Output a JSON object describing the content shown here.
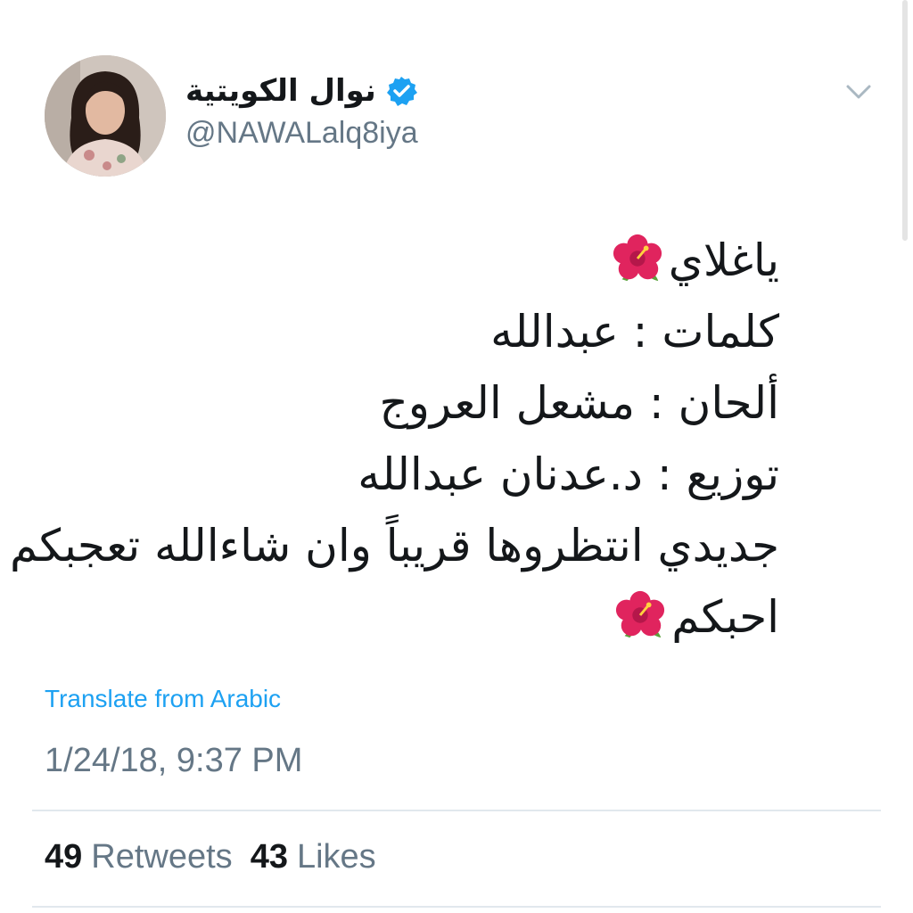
{
  "user": {
    "display_name": "نوال الكويتية",
    "handle": "@NAWALalq8iya",
    "verified_icon": "verified-badge-icon",
    "avatar_icon": "avatar-photo"
  },
  "menu_icon": "chevron-down-icon",
  "tweet": {
    "lines": [
      "ياغلاي",
      "كلمات : عبدالله",
      "ألحان : مشعل العروج",
      "توزيع : د.عدنان عبدالله",
      "جديدي انتظروها قريباً وان شاءالله تعجبكم",
      "احبكم"
    ],
    "emoji_icon": "hibiscus-icon"
  },
  "translate_label": "Translate from Arabic",
  "timestamp": "1/24/18, 9:37 PM",
  "stats": {
    "retweets_count": "49",
    "retweets_label": "Retweets",
    "likes_count": "43",
    "likes_label": "Likes"
  },
  "colors": {
    "text": "#14171a",
    "secondary": "#657786",
    "link": "#1da1f2",
    "verified": "#1da1f2",
    "hibiscus": "#e0245e"
  }
}
